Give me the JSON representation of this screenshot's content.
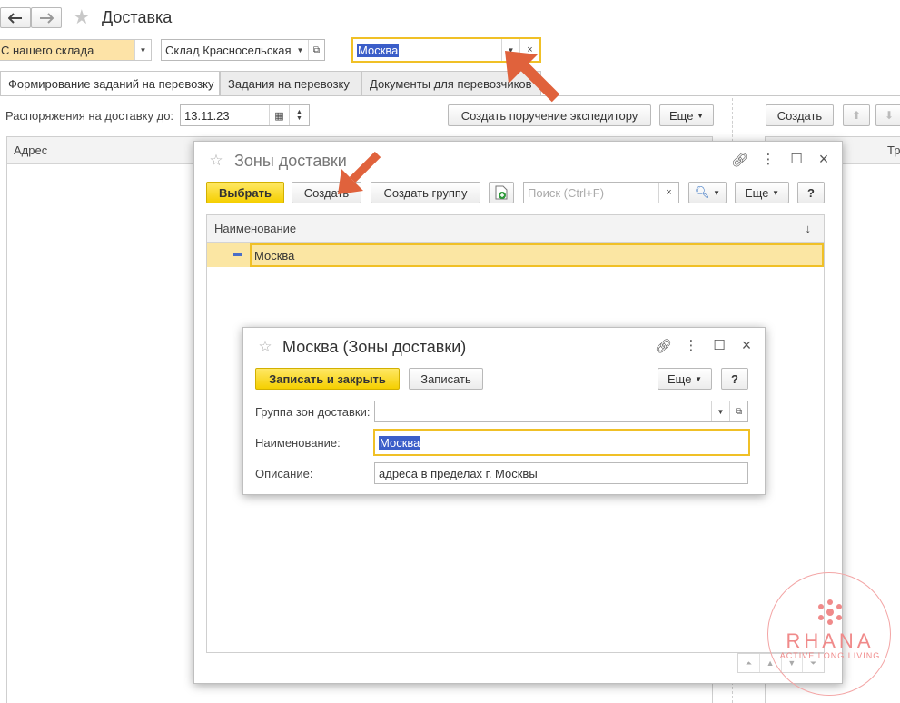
{
  "page": {
    "title": "Доставка",
    "warehouse_filter": "С нашего склада",
    "warehouse": "Склад Красносельская",
    "zone": "Москва",
    "tabs": [
      "Формирование заданий на перевозку",
      "Задания на перевозку",
      "Документы для перевозчиков"
    ],
    "date_label": "Распоряжения на доставку до:",
    "date_value": "13.11.23",
    "create_order_button": "Создать поручение экспедитору",
    "more_button": "Еще",
    "create_button": "Создать",
    "grid_col_address": "Адрес",
    "right_col_partial": "Тр"
  },
  "zones_window": {
    "title": "Зоны доставки",
    "select_button": "Выбрать",
    "create_button": "Создать",
    "create_group_button": "Создать группу",
    "search_placeholder": "Поиск (Ctrl+F)",
    "more_button": "Еще",
    "help_button": "?",
    "col_name": "Наименование",
    "sort_indicator": "↓",
    "rows": [
      "Москва"
    ]
  },
  "item_window": {
    "title": "Москва (Зоны доставки)",
    "save_close_button": "Записать и закрыть",
    "save_button": "Записать",
    "more_button": "Еще",
    "help_button": "?",
    "group_label": "Группа зон доставки:",
    "group_value": "",
    "name_label": "Наименование:",
    "name_value": "Москва",
    "desc_label": "Описание:",
    "desc_value": "адреса в пределах г. Москвы"
  },
  "watermark": {
    "brand": "RHANA",
    "tagline": "ACTIVE LONG LIVING"
  },
  "colors": {
    "accent_yellow": "#f5cf00",
    "focus_border": "#f0c026",
    "selection_row": "#fbe6a3",
    "arrow": "#e0623c",
    "watermark": "#f08a8a"
  }
}
